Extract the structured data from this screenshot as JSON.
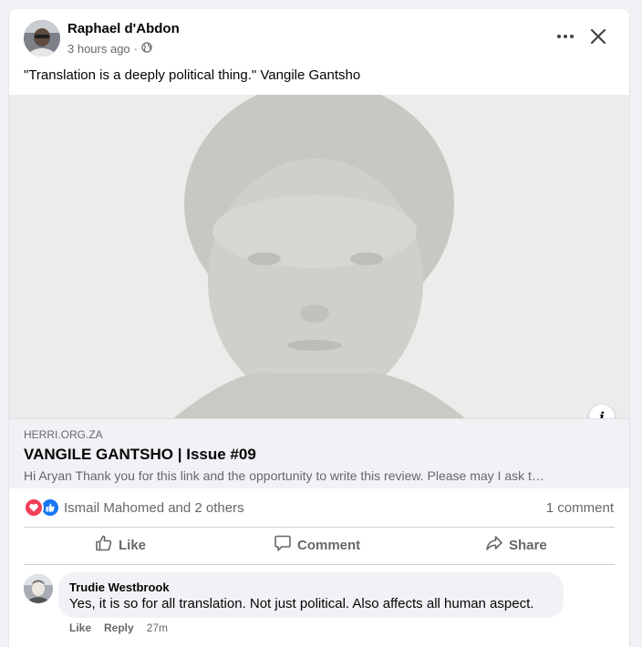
{
  "post": {
    "author": "Raphael d'Abdon",
    "time": "3 hours ago",
    "separator": "·",
    "privacy_icon": "globe-icon",
    "text": "\"Translation is a deeply political thing.\" Vangile Gantsho"
  },
  "link_preview": {
    "domain": "HERRI.ORG.ZA",
    "title": "VANGILE GANTSHO | Issue #09",
    "description": "Hi Aryan Thank you for this link and the opportunity to write this review. Please may I ask t…"
  },
  "reactions": {
    "summary": "Ismail Mahomed and 2 others",
    "types": [
      "love",
      "like"
    ]
  },
  "comments_count": "1 comment",
  "actions": {
    "like": "Like",
    "comment": "Comment",
    "share": "Share"
  },
  "comment": {
    "author": "Trudie Westbrook",
    "text": "Yes, it is so for all translation. Not just political. Also affects all human aspect.",
    "like": "Like",
    "reply": "Reply",
    "time": "27m"
  },
  "colors": {
    "like_blue": "#1877f2",
    "love_red": "#f33e58",
    "secondary_text": "#65676b",
    "bubble_bg": "#f0f2f5"
  }
}
